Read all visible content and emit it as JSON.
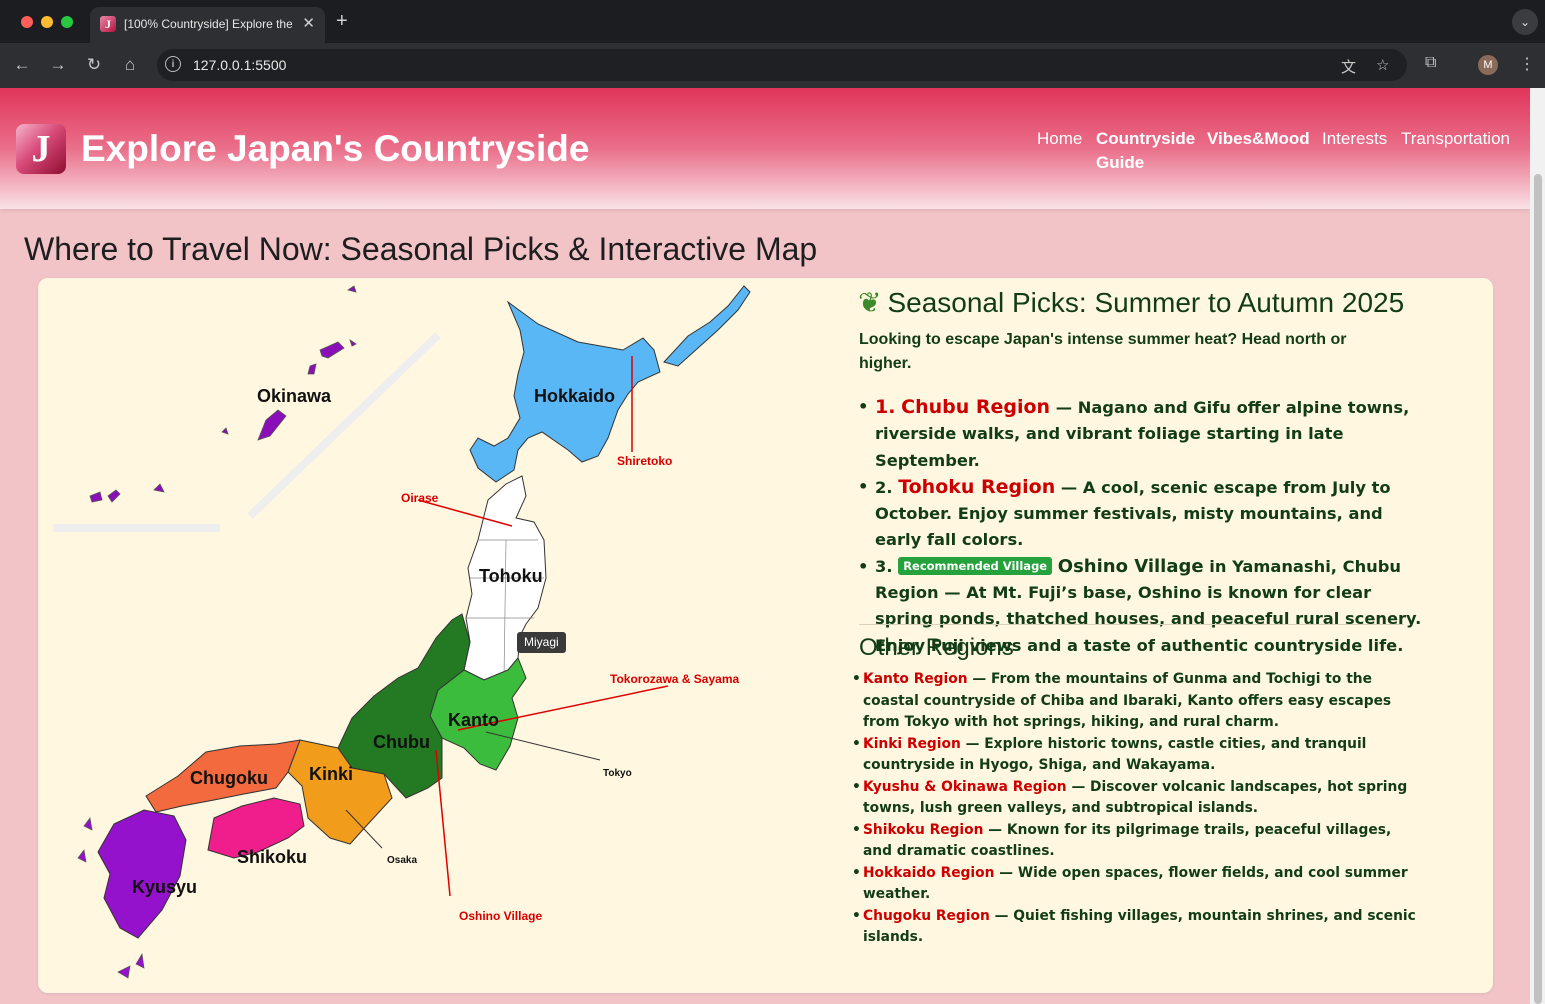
{
  "browser": {
    "tab_title": "[100% Countryside] Explore the",
    "tab_favicon": "J",
    "url": "127.0.0.1:5500",
    "profile_initial": "M"
  },
  "site": {
    "logo_letter": "J",
    "title": "Explore Japan's Countryside",
    "nav": [
      {
        "label": "Home",
        "active": false
      },
      {
        "label": "Countryside",
        "active": true
      },
      {
        "label": "Guide",
        "active": true
      },
      {
        "label": "Vibes&Mood",
        "active": true
      },
      {
        "label": "Interests",
        "active": false
      },
      {
        "label": "Transportation",
        "active": false
      }
    ]
  },
  "page": {
    "title": "Where to Travel Now: Seasonal Picks & Interactive Map"
  },
  "map": {
    "regions": {
      "okinawa": "Okinawa",
      "hokkaido": "Hokkaido",
      "tohoku": "Tohoku",
      "kanto": "Kanto",
      "chubu": "Chubu",
      "chugoku": "Chugoku",
      "kinki": "Kinki",
      "shikoku": "Shikoku",
      "kyusyu": "Kyusyu"
    },
    "callouts": {
      "shiretoko": "Shiretoko",
      "oirase": "Oirase",
      "tokorozawa": "Tokorozawa & Sayama",
      "tokyo": "Tokyo",
      "osaka": "Osaka",
      "oshino": "Oshino Village"
    },
    "tooltip": "Miyagi",
    "colors": {
      "hokkaido": "#5ab7f5",
      "tohoku": "#ffffff",
      "kanto": "#3cbc3c",
      "chubu": "#237a23",
      "kinki": "#f29c1c",
      "chugoku": "#f26a3e",
      "shikoku": "#f01e8c",
      "kyusyu": "#9512cc",
      "okinawa": "#8a0fb8",
      "callout": "#e00000"
    }
  },
  "seasonal": {
    "heading": "Seasonal Picks: Summer to Autumn 2025",
    "icon": "herb-icon",
    "intro": "Looking to escape Japan's intense summer heat? Head north or higher.",
    "picks": [
      {
        "num": "1.",
        "name": "Chubu Region",
        "desc": "— Nagano and Gifu offer alpine towns, riverside walks, and vibrant foliage starting in late September."
      },
      {
        "num": "2.",
        "name": "Tohoku Region",
        "desc": "— A cool, scenic escape from July to October. Enjoy summer festivals, misty mountains, and early fall colors."
      },
      {
        "num": "3.",
        "badge": "Recommended Village",
        "name": "Oshino Village",
        "desc": "in Yamanashi, Chubu Region — At Mt. Fuji’s base, Oshino is known for clear spring ponds, thatched houses, and peaceful rural scenery. Enjoy Fuji views and a taste of authentic countryside life."
      }
    ]
  },
  "other": {
    "heading": "Other Regions",
    "items": [
      {
        "name": "Kanto Region",
        "desc": "— From the mountains of Gunma and Tochigi to the coastal countryside of Chiba and Ibaraki, Kanto offers easy escapes from Tokyo with hot springs, hiking, and rural charm."
      },
      {
        "name": "Kinki Region",
        "desc": "— Explore historic towns, castle cities, and tranquil countryside in Hyogo, Shiga, and Wakayama."
      },
      {
        "name": "Kyushu & Okinawa Region",
        "desc": "— Discover volcanic landscapes, hot spring towns, lush green valleys, and subtropical islands."
      },
      {
        "name": "Shikoku Region",
        "desc": "— Known for its pilgrimage trails, peaceful villages, and dramatic coastlines."
      },
      {
        "name": "Hokkaido Region",
        "desc": "— Wide open spaces, flower fields, and cool summer weather."
      },
      {
        "name": "Chugoku Region",
        "desc": "— Quiet fishing villages, mountain shrines, and scenic islands."
      }
    ]
  }
}
